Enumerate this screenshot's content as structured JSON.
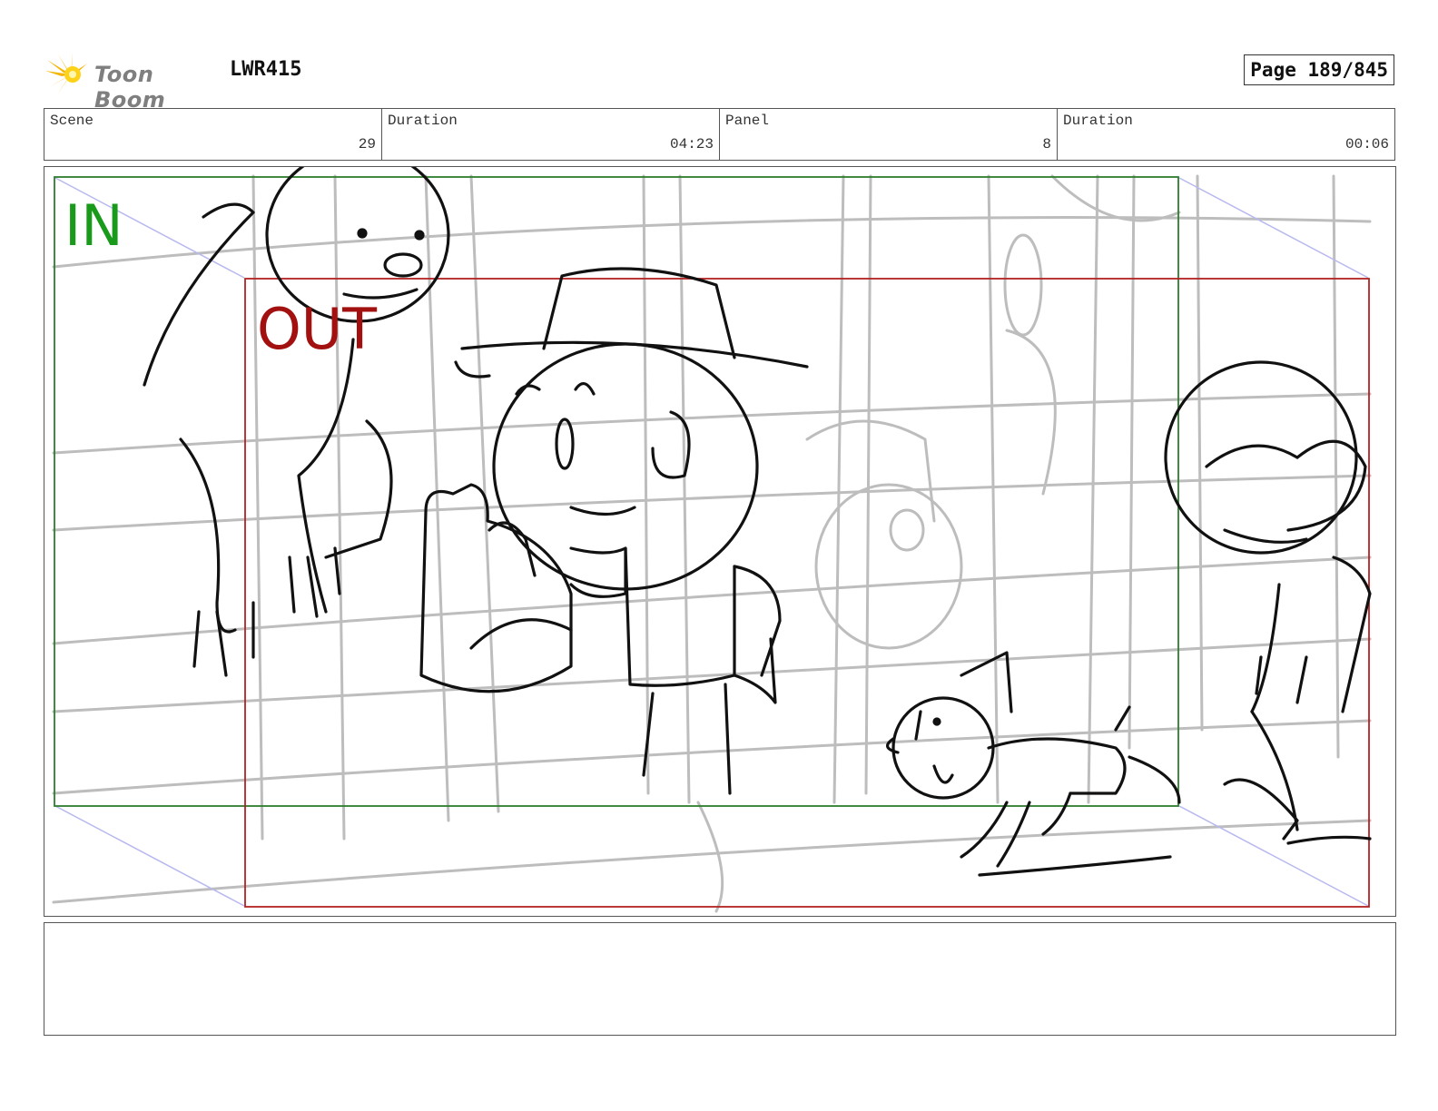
{
  "header": {
    "logo_text": "Toon Boom",
    "project": "LWR415",
    "page_label": "Page 189/845"
  },
  "info": {
    "scene_label": "Scene",
    "scene_value": "29",
    "scene_duration_label": "Duration",
    "scene_duration_value": "04:23",
    "panel_label": "Panel",
    "panel_value": "8",
    "panel_duration_label": "Duration",
    "panel_duration_value": "00:06"
  },
  "panel": {
    "in_label": "IN",
    "out_label": "OUT",
    "in_color": "#1a9a1a",
    "out_color": "#a31010"
  },
  "notes": {
    "text": ""
  }
}
